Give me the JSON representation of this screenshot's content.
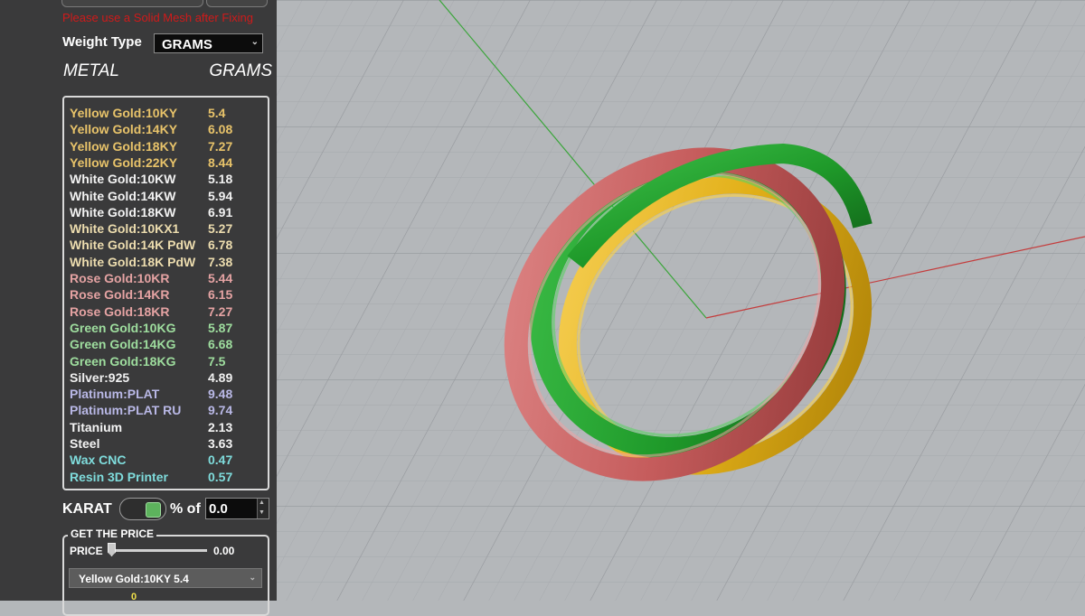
{
  "panel": {
    "warning_text": "Please use a Solid Mesh after Fixing",
    "weight_type_label": "Weight Type",
    "weight_type_value": "GRAMS",
    "col_metal": "METAL",
    "col_grams": "GRAMS",
    "metals": [
      {
        "name": "Yellow Gold:10KY",
        "grams": "5.4",
        "color": "#e8c36a"
      },
      {
        "name": "Yellow Gold:14KY",
        "grams": "6.08",
        "color": "#e8c36a"
      },
      {
        "name": "Yellow Gold:18KY",
        "grams": "7.27",
        "color": "#e8c36a"
      },
      {
        "name": "Yellow Gold:22KY",
        "grams": "8.44",
        "color": "#e8c36a"
      },
      {
        "name": "White Gold:10KW",
        "grams": "5.18",
        "color": "#f2f2f2"
      },
      {
        "name": "White Gold:14KW",
        "grams": "5.94",
        "color": "#f2f2f2"
      },
      {
        "name": "White Gold:18KW",
        "grams": "6.91",
        "color": "#f2f2f2"
      },
      {
        "name": "White Gold:10KX1",
        "grams": "5.27",
        "color": "#ecdcae"
      },
      {
        "name": "White Gold:14K PdW",
        "grams": "6.78",
        "color": "#ecdcae"
      },
      {
        "name": "White Gold:18K PdW",
        "grams": "7.38",
        "color": "#ecdcae"
      },
      {
        "name": "Rose Gold:10KR",
        "grams": "5.44",
        "color": "#e5a3a3"
      },
      {
        "name": "Rose Gold:14KR",
        "grams": "6.15",
        "color": "#e5a3a3"
      },
      {
        "name": "Rose Gold:18KR",
        "grams": "7.27",
        "color": "#e5a3a3"
      },
      {
        "name": "Green Gold:10KG",
        "grams": "5.87",
        "color": "#9edd9e"
      },
      {
        "name": "Green Gold:14KG",
        "grams": "6.68",
        "color": "#9edd9e"
      },
      {
        "name": "Green Gold:18KG",
        "grams": "7.5",
        "color": "#9edd9e"
      },
      {
        "name": "Silver:925",
        "grams": "4.89",
        "color": "#f0f0f0"
      },
      {
        "name": "Platinum:PLAT",
        "grams": "9.48",
        "color": "#b9b8e6"
      },
      {
        "name": "Platinum:PLAT RU",
        "grams": "9.74",
        "color": "#b9b8e6"
      },
      {
        "name": "Titanium",
        "grams": "2.13",
        "color": "#f4f4f4"
      },
      {
        "name": "Steel",
        "grams": "3.63",
        "color": "#f4f4f4"
      },
      {
        "name": "Wax  CNC",
        "grams": "0.47",
        "color": "#7fdcdc"
      },
      {
        "name": "Resin 3D Printer",
        "grams": "0.57",
        "color": "#7fdcdc"
      }
    ],
    "karat_label": "KARAT",
    "karat_on": true,
    "pct_label": "% of",
    "pct_value": "0.0",
    "price_group_label": "GET THE PRICE",
    "price_label": "PRICE",
    "price_value": "0.00",
    "price_slider_fraction": 0.0,
    "metal_select_value": "Yellow Gold:10KY 5.4",
    "bottom_number": "0"
  },
  "viewport": {
    "background": "#b4b7ba",
    "ring_colors": {
      "red": "#c55c5c",
      "green": "#1f9a2a",
      "yellow": "#e2b019"
    }
  }
}
